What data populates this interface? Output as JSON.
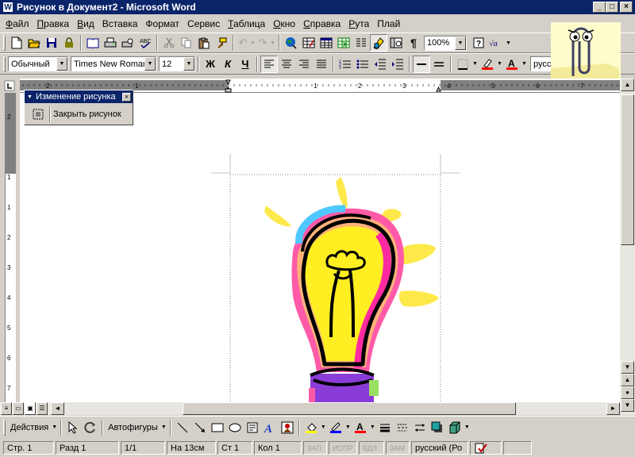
{
  "window": {
    "title": "Рисунок в Документ2 - Microsoft Word",
    "app_icon": "word-icon"
  },
  "menu": [
    {
      "u": "Ф",
      "rest": "айл"
    },
    {
      "u": "П",
      "rest": "равка"
    },
    {
      "u": "В",
      "rest": "ид"
    },
    {
      "u": "",
      "rest": "Вставка"
    },
    {
      "u": "",
      "rest": "Формат"
    },
    {
      "u": "",
      "rest": "Сервис"
    },
    {
      "u": "Т",
      "rest": "аблица"
    },
    {
      "u": "О",
      "rest": "кно"
    },
    {
      "u": "С",
      "rest": "правка"
    },
    {
      "u": "Р",
      "rest": "ута"
    },
    {
      "u": "",
      "rest": "Плай"
    }
  ],
  "standard": {
    "zoom": "100%"
  },
  "formatting": {
    "style": "Обычный",
    "font": "Times New Romar",
    "size": "12",
    "bold": "Ж",
    "italic": "К",
    "underline": "Ч",
    "lang": "русск"
  },
  "floating": {
    "title": "Изменение рисунка",
    "close_label": "Закрыть рисунок"
  },
  "drawing": {
    "actions": "Действия",
    "autoshapes": "Автофигуры"
  },
  "status": {
    "page": "Стр. 1",
    "section": "Разд 1",
    "pages": "1/1",
    "at": "На 13см",
    "line": "Ст 1",
    "col": "Кол 1",
    "rec": "ЗАП",
    "trk": "ИСПР",
    "ext": "ВДЛ",
    "ovr": "ЗАМ",
    "language": "русский (Ро"
  },
  "ruler": {
    "h_ticks": [
      "2",
      "1",
      "1",
      "2",
      "3",
      "4",
      "5",
      "6",
      "7"
    ],
    "v_ticks": [
      "2",
      "1",
      "1",
      "2",
      "3",
      "4",
      "5",
      "6",
      "7"
    ]
  },
  "colors": {
    "title": "#0a246a",
    "face": "#d4d0c8",
    "bulb_yellow": "#ffee22",
    "rays": "#ffe94a"
  }
}
